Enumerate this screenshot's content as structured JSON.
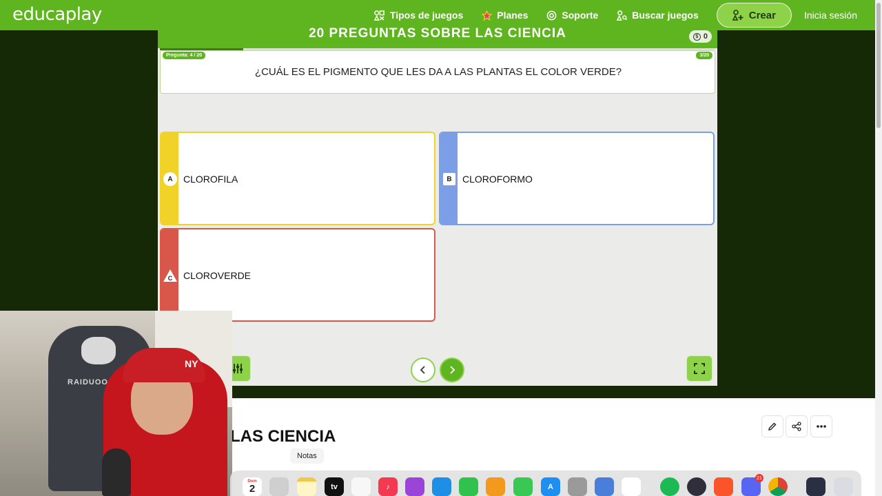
{
  "header": {
    "logo": "educaplay",
    "nav": [
      {
        "label": "Tipos de juegos",
        "icon": "shapes-icon"
      },
      {
        "label": "Planes",
        "icon": "star-icon"
      },
      {
        "label": "Soporte",
        "icon": "lifebuoy-icon"
      },
      {
        "label": "Buscar juegos",
        "icon": "search-shapes-icon"
      }
    ],
    "create_label": "Crear",
    "login_label": "Inicia sesión",
    "colors": {
      "primary": "#5fb51f",
      "accent": "#8ed24a",
      "backdrop": "#152906"
    }
  },
  "game": {
    "title": "20 PREGUNTAS SOBRE LAS CIENCIA",
    "score": "0",
    "question_counter": "Pregunta: 4 / 20",
    "right_counter": "3/20",
    "progress": 0.15,
    "question": "¿CUÁL ES EL PIGMENTO QUE LES DA A LAS PLANTAS EL COLOR VERDE?",
    "answers": [
      {
        "letter": "A",
        "text": "CLOROFILA",
        "color": "#f0d228"
      },
      {
        "letter": "B",
        "text": "CLOROFORMO",
        "color": "#7b9ee6"
      },
      {
        "letter": "C",
        "text": "CLOROVERDE",
        "color": "#d9574a"
      }
    ]
  },
  "page": {
    "heading": "LAS CIENCIA"
  },
  "dock": {
    "tooltip": "Notas",
    "calendar_month": "Dom",
    "calendar_day": "2",
    "discord_badge": "21"
  }
}
